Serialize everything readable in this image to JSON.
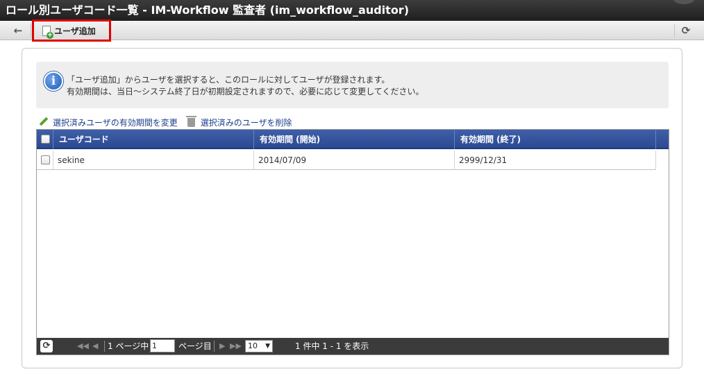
{
  "window": {
    "title": "ロール別ユーザコード一覧 - IM-Workflow 監査者 (im_workflow_auditor)"
  },
  "toolbar": {
    "back_icon": "←",
    "add_user_label": "ユーザ追加",
    "refresh_icon": "⟳"
  },
  "info": {
    "icon": "i",
    "line1": "「ユーザ追加」からユーザを選択すると、このロールに対してユーザが登録されます。",
    "line2": "有効期間は、当日～システム終了日が初期設定されますので、必要に応じて変更してください。"
  },
  "actions": {
    "change_period_label": "選択済みユーザの有効期間を変更",
    "delete_label": "選択済みのユーザを削除"
  },
  "grid": {
    "columns": [
      "ユーザコード",
      "有効期間 (開始)",
      "有効期間 (終了)"
    ],
    "rows": [
      {
        "user_code": "sekine",
        "start": "2014/07/09",
        "end": "2999/12/31"
      }
    ]
  },
  "pager": {
    "reload_icon": "⟳",
    "first_icon": "◀◀",
    "prev_icon": "◀",
    "page_prefix": "1 ページ中",
    "page_value": "1",
    "page_suffix": "ページ目",
    "next_icon": "▶",
    "last_icon": "▶▶",
    "per_page": "10",
    "summary": "1 件中 1 - 1 を表示"
  }
}
